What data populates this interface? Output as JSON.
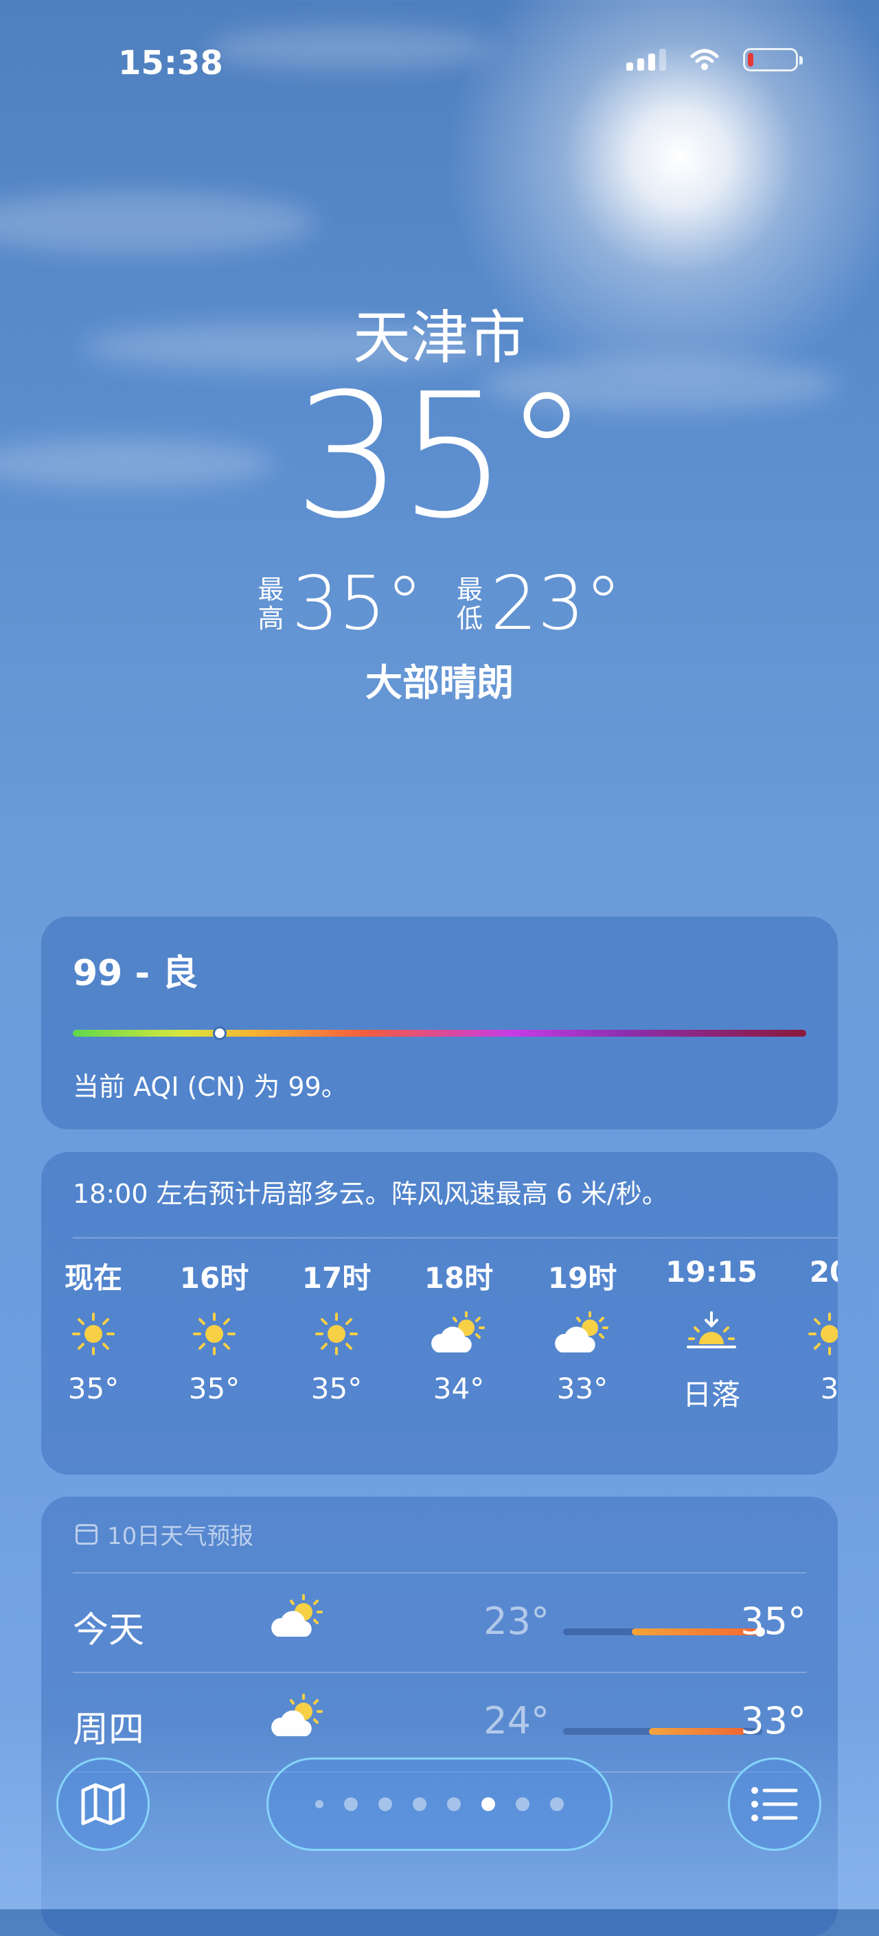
{
  "status": {
    "time": "15:38",
    "battery_color": "#e53935"
  },
  "weather": {
    "city": "天津市",
    "temp": "35°",
    "high_label": "最\n高",
    "high": "35°",
    "low_label": "最\n低",
    "low": "23°",
    "condition": "大部晴朗"
  },
  "aqi": {
    "value": "99 - 良",
    "description": "当前 AQI (CN) 为 99。",
    "level_fraction": 0.2
  },
  "hourly": {
    "summary": "18:00 左右预计局部多云。阵风风速最高 6 米/秒。",
    "items": [
      {
        "label": "现在",
        "icon": "sun-icon",
        "value": "35°"
      },
      {
        "label": "16时",
        "icon": "sun-icon",
        "value": "35°"
      },
      {
        "label": "17时",
        "icon": "sun-icon",
        "value": "35°"
      },
      {
        "label": "18时",
        "icon": "partly-cloudy-icon",
        "value": "34°"
      },
      {
        "label": "19时",
        "icon": "partly-cloudy-icon",
        "value": "33°"
      },
      {
        "label": "19:15",
        "icon": "sunset-icon",
        "value": "日落"
      },
      {
        "label": "20",
        "icon": "sun-icon",
        "value": "3"
      }
    ]
  },
  "forecast": {
    "header": "10日天气预报",
    "days": [
      {
        "day": "今天",
        "icon": "partly-cloudy-icon",
        "low": "23°",
        "high": "35°"
      },
      {
        "day": "周四",
        "icon": "partly-cloudy-icon",
        "low": "24°",
        "high": "33°"
      }
    ]
  },
  "pager": {
    "page_count": 8,
    "active_index": 5
  }
}
